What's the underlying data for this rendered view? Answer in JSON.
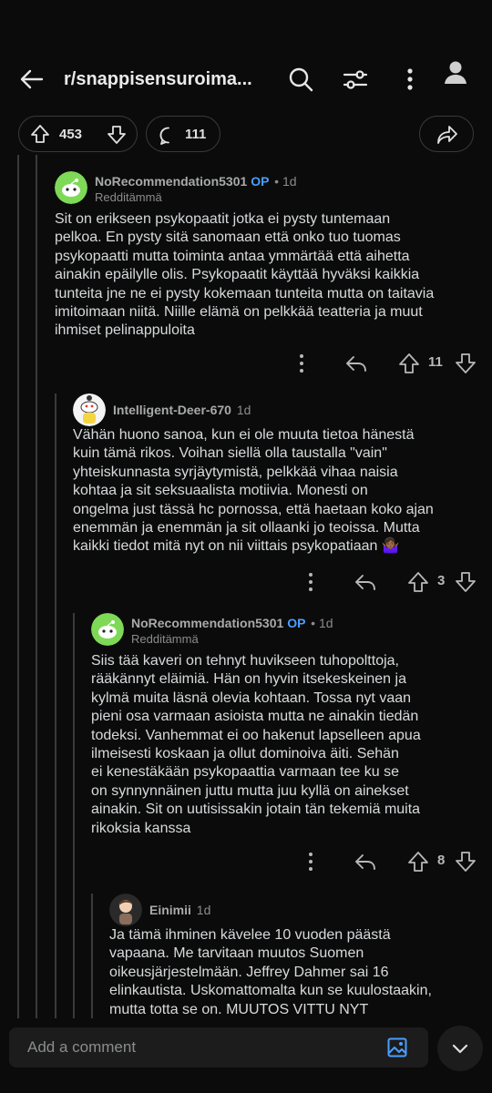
{
  "header": {
    "title": "r/snappisensuroima...",
    "icons": [
      "back-arrow-icon",
      "search-icon",
      "filter-icon",
      "more-icon",
      "profile-icon"
    ]
  },
  "actions": {
    "upvotes": "453",
    "comments": "111"
  },
  "comments": [
    {
      "author": "NoRecommendation5301",
      "op": "OP",
      "time": "• 1d",
      "flair": "Redditämmä",
      "text": "Sit on erikseen psykopaatit jotka ei pysty tuntemaan\npelkoa. En pysty sitä sanomaan että onko tuo tuomas\npsykopaatti mutta toiminta antaa ymmärtää että aihetta\nainakin epäilylle olis. Psykopaatit käyttää hyväksi kaikkia\ntunteita jne ne ei pysty kokemaan tunteita mutta on taitavia\nimitoimaan niitä. Niille elämä on pelkkää teatteria ja muut\nihmiset pelinappuloita",
      "votes": "11"
    },
    {
      "author": "Intelligent-Deer-670",
      "time": "1d",
      "text": "Vähän huono sanoa, kun ei ole muuta tietoa hänestä\nkuin tämä rikos. Voihan siellä olla taustalla \"vain\"\nyhteiskunnasta syrjäytymistä, pelkkää vihaa naisia\nkohtaa ja sit seksuaalista motiivia. Monesti on\nongelma just tässä hc pornossa, että haetaan koko ajan\nenemmän ja enemmän ja sit ollaanki jo teoissa. Mutta\nkaikki tiedot mitä nyt on nii viittais psykopatiaan 🤷🏾‍♀️",
      "votes": "3"
    },
    {
      "author": "NoRecommendation5301",
      "op": "OP",
      "time": "• 1d",
      "flair": "Redditämmä",
      "text": "Siis tää kaveri on tehnyt huvikseen tuhopolttoja,\nrääkännyt eläimiä. Hän on hyvin itsekeskeinen ja\nkylmä muita läsnä olevia kohtaan. Tossa nyt vaan\npieni osa varmaan asioista mutta ne ainakin tiedän\ntodeksi. Vanhemmat ei oo hakenut lapselleen apua\nilmeisesti koskaan ja ollut dominoiva äiti. Sehän\nei kenestäkään psykopaattia varmaan tee ku se\non synnynnäinen juttu mutta juu kyllä on ainekset\nainakin. Sit on uutisissakin jotain tän tekemiä muita\nrikoksia kanssa",
      "votes": "8"
    },
    {
      "author": "Einimii",
      "time": "1d",
      "text": "Ja tämä ihminen kävelee 10 vuoden päästä\nvapaana. Me tarvitaan muutos Suomen\noikeusjärjestelmään. Jeffrey Dahmer sai 16\nelinkautista. Uskomattomalta kun se kuulostaakin,\nmutta totta se on. MUUTOS VITTU NYT"
    }
  ],
  "composer": {
    "placeholder": "Add a comment"
  }
}
